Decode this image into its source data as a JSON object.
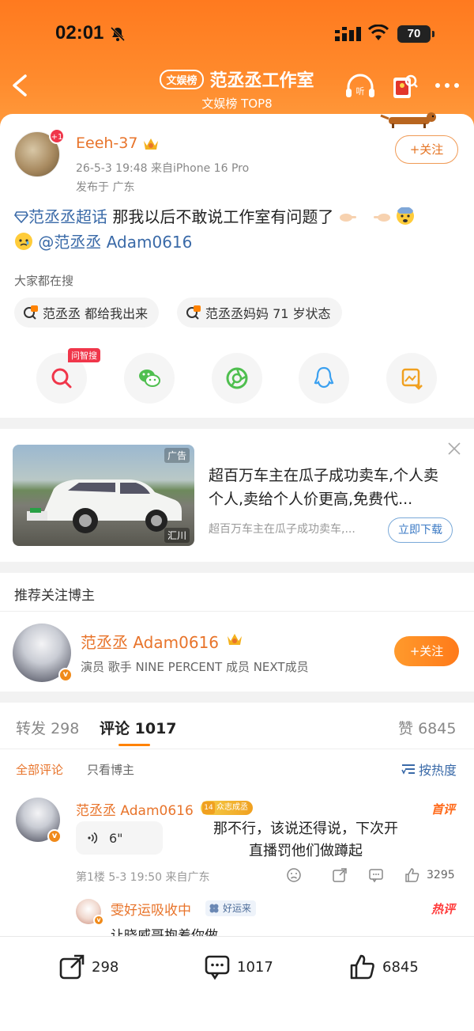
{
  "status_bar": {
    "time": "02:01",
    "battery": "70"
  },
  "header": {
    "tag": "文娱榜",
    "title": "范丞丞工作室",
    "subtitle": "文娱榜 TOP8"
  },
  "post": {
    "author": "Eeeh-37",
    "avatar_badge": "+1",
    "meta": "26-5-3 19:48  来自iPhone 16 Pro",
    "location": "发布于 广东",
    "follow_label": "+关注",
    "topic": "范丞丞超话",
    "text": " 那我以后不敢说工作室有问题了",
    "mention": "@范丞丞 Adam0616"
  },
  "search": {
    "title": "大家都在搜",
    "items": [
      {
        "label": "范丞丞 都给我出来"
      },
      {
        "label": "范丞丞妈妈 71 岁状态"
      }
    ]
  },
  "share": {
    "ask_tag": "问智搜"
  },
  "ad": {
    "tag": "广告",
    "source": "汇川",
    "title": "超百万车主在瓜子成功卖车,个人卖个人,卖给个人价更高,免费代...",
    "subtitle": "超百万车主在瓜子成功卖车,...",
    "button": "立即下载"
  },
  "recommend": {
    "title": "推荐关注博主",
    "name": "范丞丞 Adam0616",
    "desc": "演员 歌手 NINE PERCENT 成员 NEXT成员",
    "follow_label": "+关注"
  },
  "tabs": {
    "repost_label": "转发",
    "repost_count": "298",
    "comment_label": "评论",
    "comment_count": "1017",
    "like_label": "赞",
    "like_count": "6845"
  },
  "filters": {
    "all": "全部评论",
    "author_only": "只看博主",
    "sort": "按热度"
  },
  "comment": {
    "author": "范丞丞 Adam0616",
    "fan_level": "14",
    "fan_badge": "众志成丞",
    "top_badge": "首评",
    "voice_duration": "6\"",
    "transcript": "那不行，该说还得说，下次开直播罚他们做蹲起",
    "meta": "第1楼  5-3 19:50  来自广东",
    "like_count": "3295"
  },
  "reply": {
    "author": "雯好运吸收中",
    "badge": "好运来",
    "hot_badge": "热评",
    "text": "让晓威哥抱着你做"
  },
  "bottom_bar": {
    "repost": "298",
    "comment": "1017",
    "like": "6845"
  }
}
